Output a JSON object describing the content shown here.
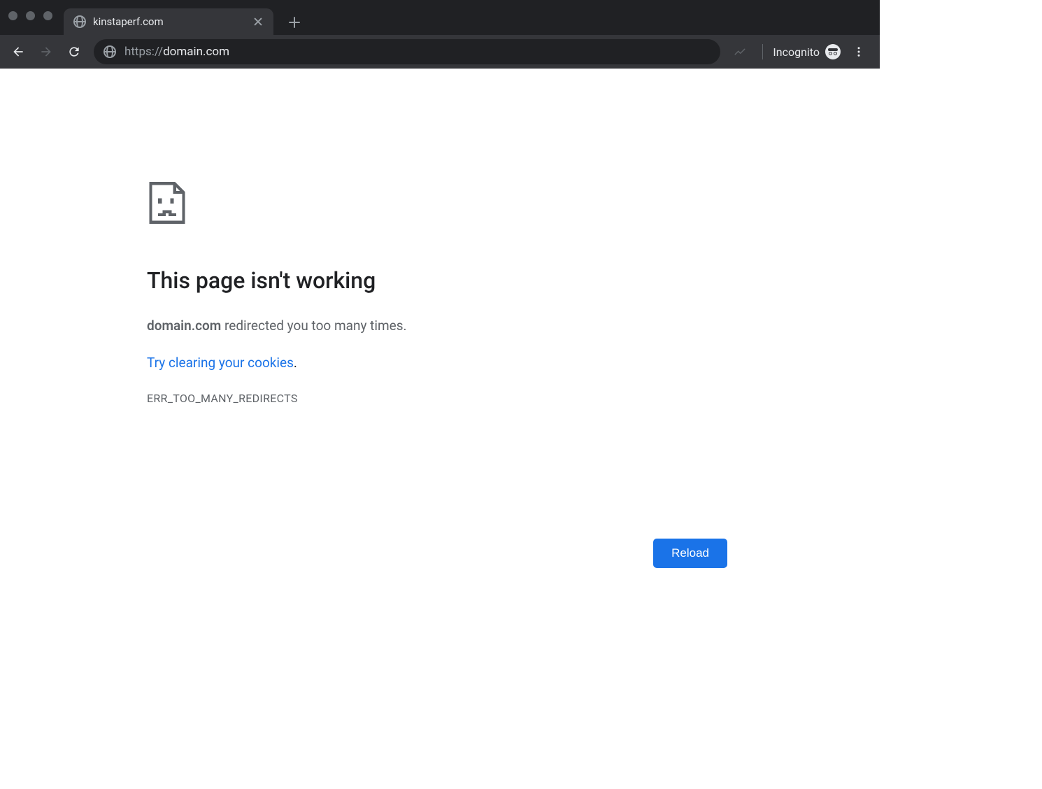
{
  "browser": {
    "tab_title": "kinstaperf.com",
    "url_scheme": "https://",
    "url_rest": "domain.com",
    "incognito_label": "Incognito"
  },
  "error": {
    "title": "This page isn't working",
    "host": "domain.com",
    "message_after_host": " redirected you too many times.",
    "link_text": "Try clearing your cookies",
    "link_period": ".",
    "code": "ERR_TOO_MANY_REDIRECTS",
    "reload_label": "Reload"
  }
}
